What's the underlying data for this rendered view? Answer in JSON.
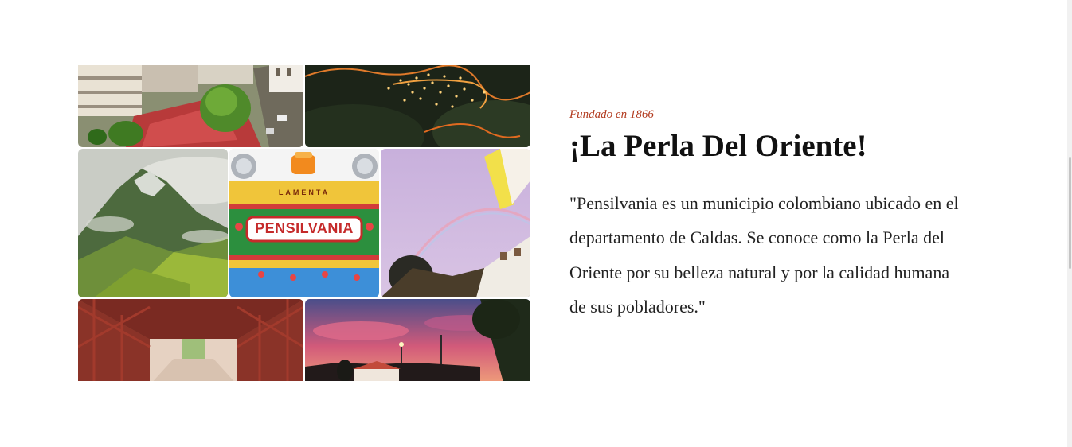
{
  "hero": {
    "subtitle": "Fundado en 1866",
    "title": "¡La Perla Del Oriente!",
    "description": "\"Pensilvania es un municipio colombiano ubicado en el departamento de Caldas. Se conoce como la Perla del Oriente por su belleza natural y por la calidad humana de sus pobladores.\""
  },
  "gallery": {
    "sign_text": "PENSILVANIA",
    "sign_top_text": "LAMENTA",
    "colors": {
      "accent": "#b23a1e",
      "title": "#111111"
    }
  }
}
